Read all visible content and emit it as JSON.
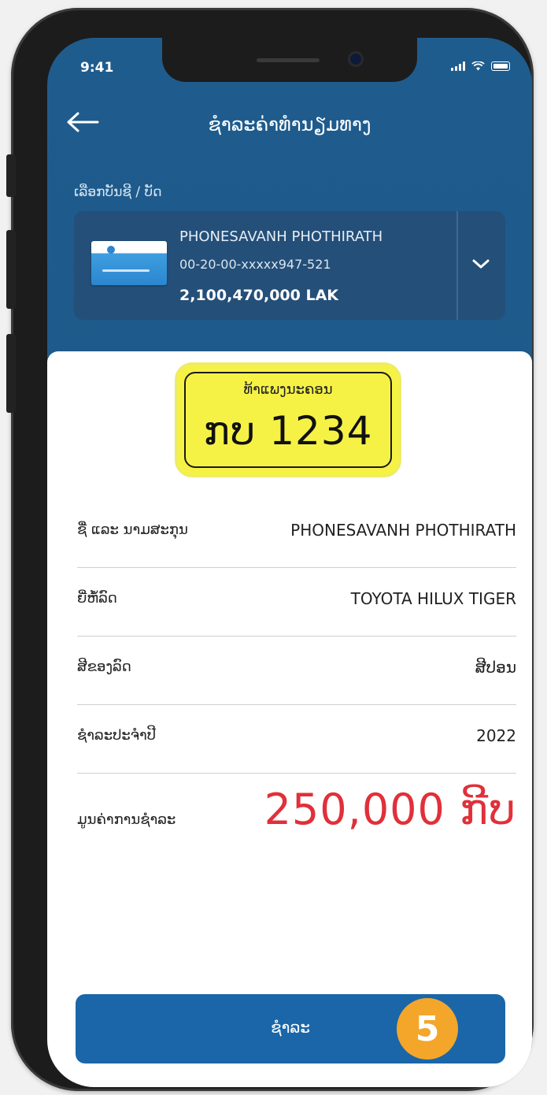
{
  "status_bar": {
    "time": "9:41"
  },
  "header": {
    "title": "ຊຳລະຄ່າທຳນຽມທາງ"
  },
  "account": {
    "label": "ເລືອກບັນຊີ / ບັດ",
    "holder_name": "PHONESAVANH PHOTHIRATH",
    "number": "00-20-00-xxxxx947-521",
    "balance": "2,100,470,000 LAK"
  },
  "plate": {
    "caption": "ທ້າແພງນະຄອນ",
    "number": "ກບ 1234"
  },
  "details": [
    {
      "label": "ຊື່ ແລະ ນາມສະກຸນ",
      "value": "PHONESAVANH PHOTHIRATH"
    },
    {
      "label": "ຍີ່ຫໍ້ລົດ",
      "value": "TOYOTA HILUX TIGER"
    },
    {
      "label": "ສີຂອງລົດ",
      "value": "ສີປອນ"
    },
    {
      "label": "ຊຳລະປະຈຳປີ",
      "value": "2022"
    }
  ],
  "total": {
    "label": "ມູນຄ່າການຊຳລະ",
    "value": "250,000 ກີບ"
  },
  "pay_button": {
    "label": "ຊຳລະ",
    "step_number": "5"
  },
  "colors": {
    "brand_blue": "#1e5a8a",
    "button_blue": "#1a66a8",
    "amount_red": "#e0303a",
    "plate_yellow": "#f6f245",
    "badge_orange": "#f4a62a"
  },
  "icons": [
    "back-arrow-icon",
    "chevron-down-icon",
    "signal-icon",
    "wifi-icon",
    "battery-icon"
  ]
}
